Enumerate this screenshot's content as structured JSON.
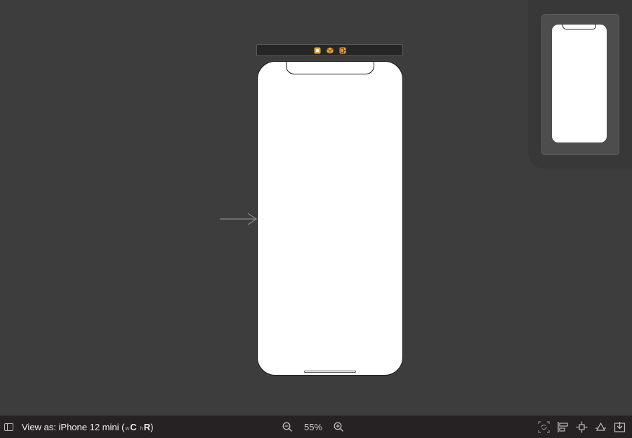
{
  "toolbar": {
    "view_as_prefix": "View as: ",
    "device_name": "iPhone 12 mini",
    "paren_open": "(",
    "width_size_letter": "w",
    "width_class": "C",
    "height_size_letter": "h",
    "height_class": "R",
    "paren_close": ")",
    "zoom_level": "55%"
  },
  "icons": {
    "sidebar_toggle": "sidebar-toggle-icon",
    "zoom_out": "zoom-out-icon",
    "zoom_in": "zoom-in-icon",
    "update_frames": "update-frames-icon",
    "align": "align-icon",
    "add_constraints": "add-constraints-icon",
    "resolve_issues": "resolve-autolayout-issues-icon",
    "embed_in": "embed-in-icon",
    "view_controller": "view-controller-icon",
    "first_responder": "first-responder-icon",
    "exit": "exit-icon"
  },
  "colors": {
    "canvas": "#3d3d3d",
    "toolbar": "#262223",
    "dock_accent": "#e8a33d"
  }
}
